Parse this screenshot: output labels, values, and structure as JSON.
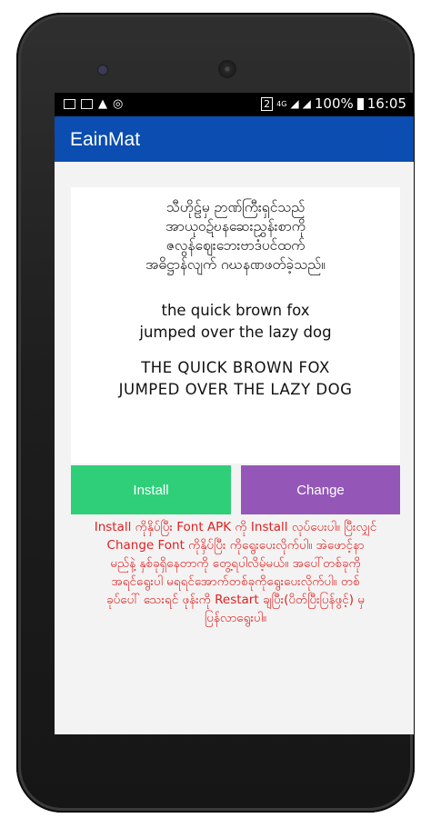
{
  "status_bar": {
    "battery": "100%",
    "time": "16:05",
    "sim": "2",
    "network": "4G"
  },
  "app": {
    "title": "EainMat"
  },
  "preview": {
    "myanmar_lines": [
      "သီဟိုဠ်မှ ဉာဏ်ကြီးရှင်သည်",
      "အာယုဝဍ်ဎနဆေးညွှန်းစာကို",
      "ဇလွန်ဈေးဘေးဗာဒံပင်ထက်",
      "အဓိဋ္ဌာန်လျက် ဂဃနဏဖတ်ခဲ့သည်။"
    ],
    "lowercase_lines": [
      "the quick brown fox",
      "jumped over the lazy dog"
    ],
    "uppercase_lines": [
      "THE QUICK BROWN FOX",
      "JUMPED OVER THE LAZY DOG"
    ]
  },
  "buttons": {
    "install": "Install",
    "change": "Change"
  },
  "instructions": [
    "Install ကိုနှိပ်ပြီး Font APK ကို Install လုပ်ပေးပါ။ ပြီးလျှင်",
    "Change Font ကိုနှိပ်ပြီး ကိုရွေးပေးလိုက်ပါ။ အဲဖောင့်နာ",
    "မည်နဲ့ နှစ်ခုရှိနေတာကို တွေ့ရပါလိမ့်မယ်။ အပေါ်တစ်ခုကို",
    "အရင်ရွေးပါ မရရင်အောက်တစ်ခုကိုရွေးပေးလိုက်ပါ။ တစ်",
    "ခုပ်ပေါ် သေးရင် ဖုန်းကို Restart ချပြီး(ပိတ်ပြီးပြန်ဖွင့်) မှ",
    "ပြန်လာရွေးပါ။"
  ],
  "colors": {
    "app_bar": "#0b4db0",
    "install_button": "#2fcf7a",
    "change_button": "#9457b8",
    "instruction_text": "#e02020"
  }
}
